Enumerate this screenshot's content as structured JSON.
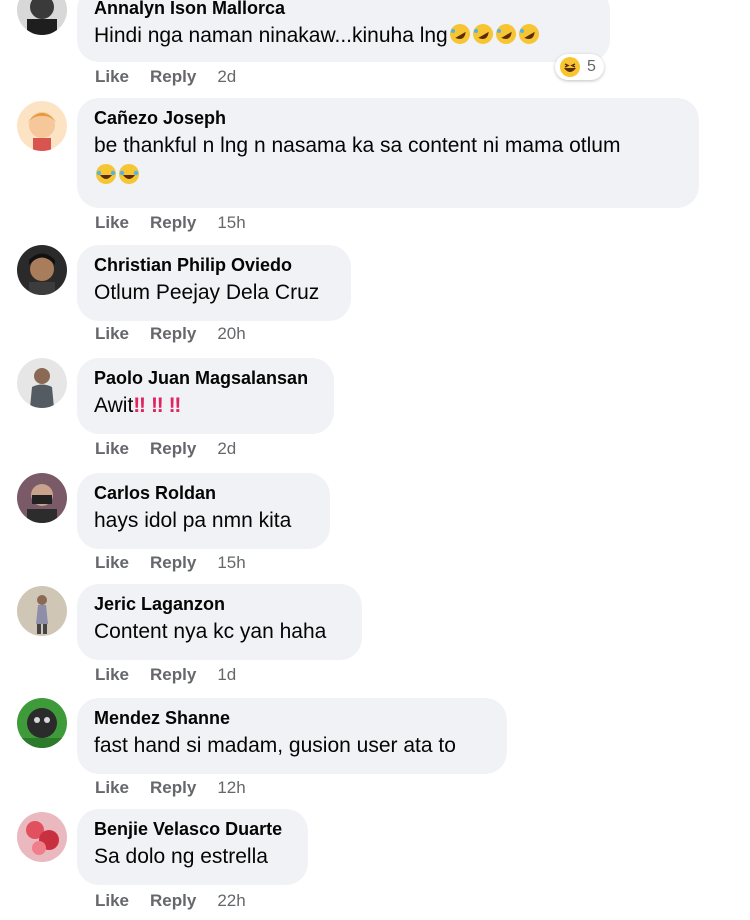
{
  "comments": [
    {
      "author": "Annalyn Ison Mallorca",
      "text": "Hindi nga naman ninakaw...kinuha lng",
      "emoji_after_text": [
        "rofl-emoji",
        "rofl-emoji",
        "rofl-emoji",
        "rofl-emoji"
      ],
      "like": "Like",
      "reply": "Reply",
      "time": "2d",
      "reaction_count": "5"
    },
    {
      "author": "Cañezo Joseph",
      "text": "be thankful n lng n nasama ka sa content ni mama otlum",
      "emoji_line": [
        "joy-emoji",
        "joy-emoji"
      ],
      "like": "Like",
      "reply": "Reply",
      "time": "15h"
    },
    {
      "author": "Christian Philip Oviedo",
      "text": "Otlum Peejay Dela Cruz",
      "like": "Like",
      "reply": "Reply",
      "time": "20h"
    },
    {
      "author": "Paolo Juan Magsalansan",
      "text": "Awit",
      "bangs": [
        "‼",
        "‼",
        "‼"
      ],
      "like": "Like",
      "reply": "Reply",
      "time": "2d"
    },
    {
      "author": "Carlos Roldan",
      "text": "hays idol pa nmn kita",
      "like": "Like",
      "reply": "Reply",
      "time": "15h"
    },
    {
      "author": "Jeric Laganzon",
      "text": "Content nya kc yan haha",
      "like": "Like",
      "reply": "Reply",
      "time": "1d"
    },
    {
      "author": "Mendez Shanne",
      "text": "fast hand si madam, gusion user ata to",
      "like": "Like",
      "reply": "Reply",
      "time": "12h"
    },
    {
      "author": "Benjie Velasco Duarte",
      "text": "Sa dolo ng estrella",
      "like": "Like",
      "reply": "Reply",
      "time": "22h"
    }
  ],
  "colors": {
    "bubble": "#f0f2f5",
    "meta": "#65676b",
    "text": "#050505",
    "emoji": "#f7c531"
  }
}
